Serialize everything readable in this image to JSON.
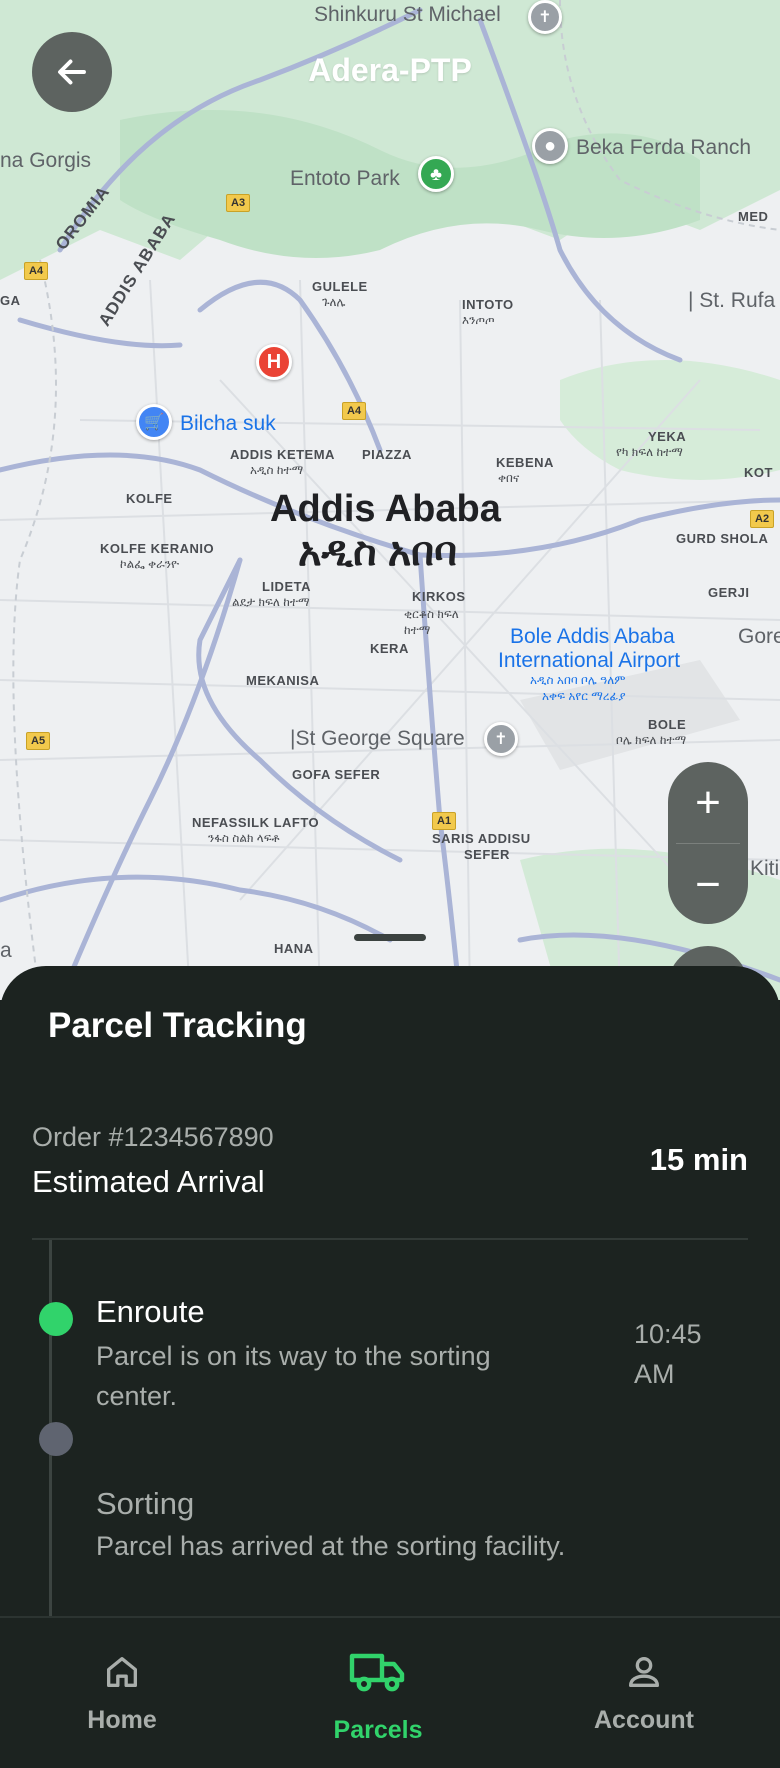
{
  "header": {
    "title": "Adera-PTP",
    "back_icon": "arrow-left-icon"
  },
  "map": {
    "labels": {
      "shinkuru": "Shinkuru St Michael",
      "gorgis": "na Gorgis",
      "entoto": "Entoto Park",
      "beka": "Beka Ferda Ranch",
      "oromia": "OROMIA",
      "addis_admin": "ADDIS ABABA",
      "gulele": "GULELE",
      "gulele_amh": "ጉለሌ",
      "intoto": "INTOTO",
      "intoto_amh": "እንጦጦ",
      "st_rufa": "| St. Rufa",
      "med": "MED",
      "bilcha": "Bilcha suk",
      "addis_ketema": "ADDIS KETEMA",
      "addis_ketema_amh": "አዲስ ከተማ",
      "piazza": "PIAZZA",
      "kebena": "KEBENA",
      "kebena_amh": "ቀበና",
      "yeka": "YEKA",
      "yeka_amh": "የካ ክፍለ ከተማ",
      "kot": "KOT",
      "kolfe": "KOLFE",
      "city": "Addis Ababa",
      "city_amh": "አዲስ አበባ",
      "kolfe_keranio": "KOLFE KERANIO",
      "kolfe_keranio_amh": "ኮልፌ ቀራንዮ",
      "gurd_shola": "GURD SHOLA",
      "lideta": "LIDETA",
      "lideta_amh": "ልደታ ክፍለ ከተማ",
      "kirkos": "KIRKOS",
      "kirkos_amh": "ቂርቆስ ክፍለ ከተማ",
      "gerji": "GERJI",
      "gore": "Gore",
      "kera": "KERA",
      "airport1": "Bole Addis Ababa",
      "airport2": "International Airport",
      "airport_amh1": "አዲስ አበባ ቦሌ ዓለም",
      "airport_amh2": "አቀፍ አየር ማረፊያ",
      "mekanisa": "MEKANISA",
      "st_george": "|St George Square",
      "bole": "BOLE",
      "bole_amh": "ቦሌ ክፍለ ከተማ",
      "gofa": "GOFA SEFER",
      "nefas": "NEFASSILK LAFTO",
      "nefas_amh": "ንፋስ ስልክ ላፍቶ",
      "saris": "SARIS ADDISU",
      "sefer": "SEFER",
      "kiti": "Kiti",
      "hana": "HANA",
      "a_label": "a",
      "ga": "GA",
      "hospital_letter": "H"
    },
    "shields": {
      "a3": "A3",
      "a4_left": "A4",
      "a4_mid": "A4",
      "a2": "A2",
      "a5": "A5",
      "a1": "A1"
    },
    "zoom_in": "+",
    "zoom_out": "−"
  },
  "tracking": {
    "title": "Parcel Tracking",
    "order_number": "Order #1234567890",
    "eta_label": "Estimated Arrival",
    "eta_value": "15 min",
    "steps": [
      {
        "title": "Enroute",
        "description": "Parcel is on its way to the sorting center.",
        "time_line1": "10:45",
        "time_line2": "AM",
        "status": "active"
      },
      {
        "title": "Sorting",
        "description": "Parcel has arrived at the sorting facility.",
        "status": "pending"
      }
    ]
  },
  "nav": {
    "items": [
      {
        "label": "Home",
        "icon": "home-icon",
        "active": false
      },
      {
        "label": "Parcels",
        "icon": "truck-icon",
        "active": true
      },
      {
        "label": "Account",
        "icon": "person-icon",
        "active": false
      }
    ]
  },
  "colors": {
    "accent": "#31d36b",
    "sheet_bg": "#1c2320",
    "muted_text": "#a9aeab",
    "control_bg": "#5d6360"
  }
}
